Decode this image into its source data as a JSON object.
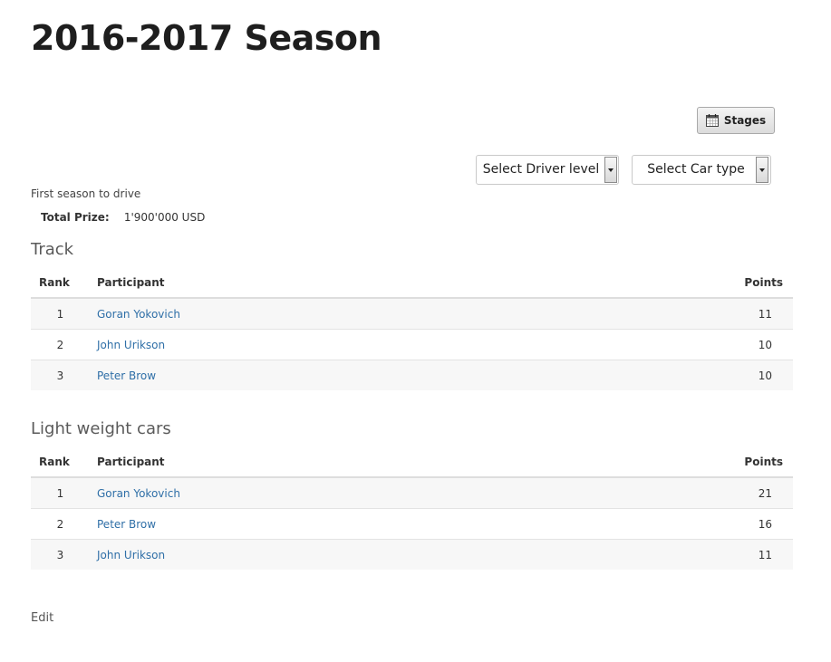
{
  "page": {
    "title": "2016-2017 Season"
  },
  "toolbar": {
    "stages_label": "Stages"
  },
  "filters": {
    "driver_level": "Select Driver level",
    "car_type": "Select Car type"
  },
  "season": {
    "description": "First season to drive",
    "total_prize_label": "Total Prize:",
    "total_prize_value": "1'900'000 USD"
  },
  "tables": {
    "headers": {
      "rank": "Rank",
      "participant": "Participant",
      "points": "Points"
    },
    "track": {
      "title": "Track",
      "rows": [
        {
          "rank": "1",
          "participant": "Goran Yokovich",
          "points": "11"
        },
        {
          "rank": "2",
          "participant": "John Urikson",
          "points": "10"
        },
        {
          "rank": "3",
          "participant": "Peter Brow",
          "points": "10"
        }
      ]
    },
    "light_weight_cars": {
      "title": "Light weight cars",
      "rows": [
        {
          "rank": "1",
          "participant": "Goran Yokovich",
          "points": "21"
        },
        {
          "rank": "2",
          "participant": "Peter Brow",
          "points": "16"
        },
        {
          "rank": "3",
          "participant": "John Urikson",
          "points": "11"
        }
      ]
    }
  },
  "footer": {
    "edit_label": "Edit"
  },
  "colors": {
    "link": "#2f6fa7",
    "title": "#1e1e1e",
    "row_stripe": "#f7f7f7"
  }
}
